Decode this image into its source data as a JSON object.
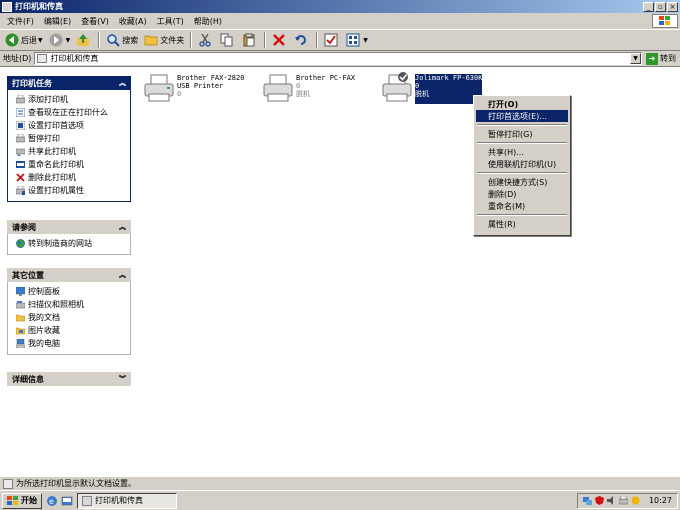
{
  "window": {
    "title": "打印机和传真",
    "minimize": "_",
    "maximize": "▫",
    "close": "×"
  },
  "menu": [
    {
      "label": "文件(F)"
    },
    {
      "label": "编辑(E)"
    },
    {
      "label": "查看(V)"
    },
    {
      "label": "收藏(A)"
    },
    {
      "label": "工具(T)"
    },
    {
      "label": "帮助(H)"
    }
  ],
  "toolbar": {
    "back_label": "后退",
    "search_label": "搜索",
    "folders_label": "文件夹"
  },
  "address": {
    "label": "地址(D)",
    "value": "打印机和传真",
    "go_label": "转到"
  },
  "tasks_panel": {
    "title": "打印机任务",
    "items": [
      {
        "label": "添加打印机"
      },
      {
        "label": "查看现在正在打印什么"
      },
      {
        "label": "设置打印首选项"
      },
      {
        "label": "暂停打印"
      },
      {
        "label": "共享此打印机"
      },
      {
        "label": "重命名此打印机"
      },
      {
        "label": "删除此打印机"
      },
      {
        "label": "设置打印机属性"
      }
    ]
  },
  "see_also_panel": {
    "title": "请参阅",
    "items": [
      {
        "label": "转到制造商的网站"
      }
    ]
  },
  "other_places_panel": {
    "title": "其它位置",
    "items": [
      {
        "label": "控制面板"
      },
      {
        "label": "扫描仪和照相机"
      },
      {
        "label": "我的文档"
      },
      {
        "label": "图片收藏"
      },
      {
        "label": "我的电脑"
      }
    ]
  },
  "details_panel": {
    "title": "详细信息"
  },
  "printers": [
    {
      "name_line1": "Brother FAX-2820",
      "name_line2": "USB Printer",
      "count": "0",
      "status": ""
    },
    {
      "name_line1": "Brother PC-FAX",
      "name_line2": "",
      "count": "0",
      "status": "脱机"
    },
    {
      "name_line1": "Jolimark FP-630K",
      "name_line2": "",
      "count": "0",
      "status": "脱机"
    }
  ],
  "context_menu": {
    "items": [
      {
        "label": "打开(O)"
      },
      {
        "label": "打印首选项(E)..."
      },
      {
        "label": "暂停打印(G)"
      },
      {
        "label": "共享(H)..."
      },
      {
        "label": "使用联机打印机(U)"
      },
      {
        "label": "创建快捷方式(S)"
      },
      {
        "label": "删除(D)"
      },
      {
        "label": "重命名(M)"
      },
      {
        "label": "属性(R)"
      }
    ]
  },
  "status_bar": {
    "text": "为所选打印机显示默认文档设置。"
  },
  "taskbar": {
    "start_label": "开始",
    "task_label": "打印机和传真",
    "clock": "10:27"
  }
}
